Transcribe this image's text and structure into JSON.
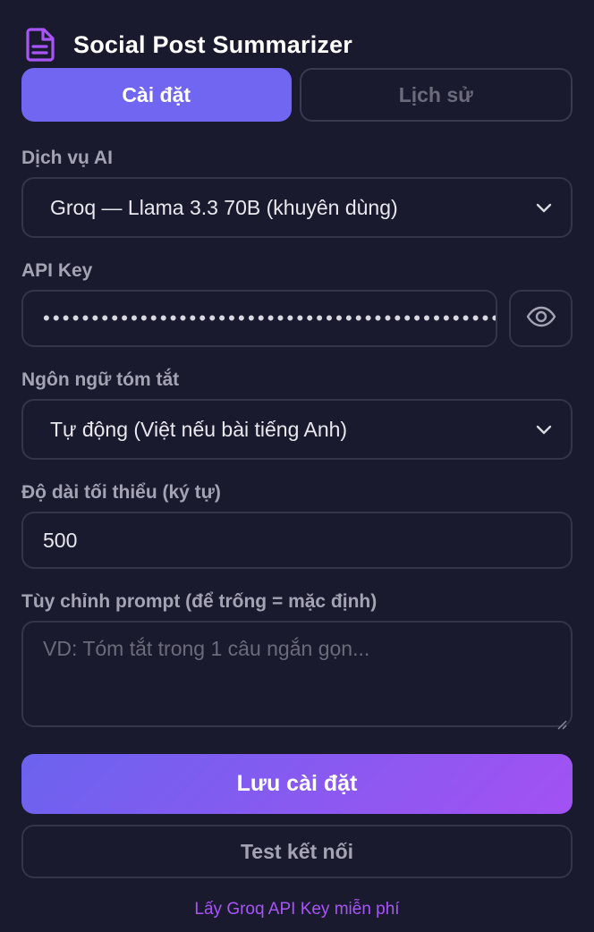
{
  "header": {
    "title": "Social Post Summarizer",
    "icon": "document-icon",
    "accent": "#a855f7"
  },
  "tabs": [
    {
      "label": "Cài đặt",
      "active": true
    },
    {
      "label": "Lịch sử",
      "active": false
    }
  ],
  "ai_service": {
    "label": "Dịch vụ AI",
    "selected": "Groq — Llama 3.3 70B (khuyên dùng)"
  },
  "api_key": {
    "label": "API Key",
    "masked_value": "••••••••••••••••••••••••••••••••••••••••••••••••••••••••"
  },
  "language": {
    "label": "Ngôn ngữ tóm tắt",
    "selected": "Tự động (Việt nếu bài tiếng Anh)"
  },
  "min_length": {
    "label": "Độ dài tối thiểu (ký tự)",
    "value": "500"
  },
  "custom_prompt": {
    "label": "Tùy chỉnh prompt (để trống = mặc định)",
    "placeholder": "VD: Tóm tắt trong 1 câu ngắn gọn..."
  },
  "buttons": {
    "save": "Lưu cài đặt",
    "test": "Test kết nối"
  },
  "footer_link": "Lấy Groq API Key miễn phí",
  "colors": {
    "background": "#1a1a2e",
    "primary": "#7166f2",
    "gradient_end": "#a351f2",
    "link": "#a855f7"
  }
}
